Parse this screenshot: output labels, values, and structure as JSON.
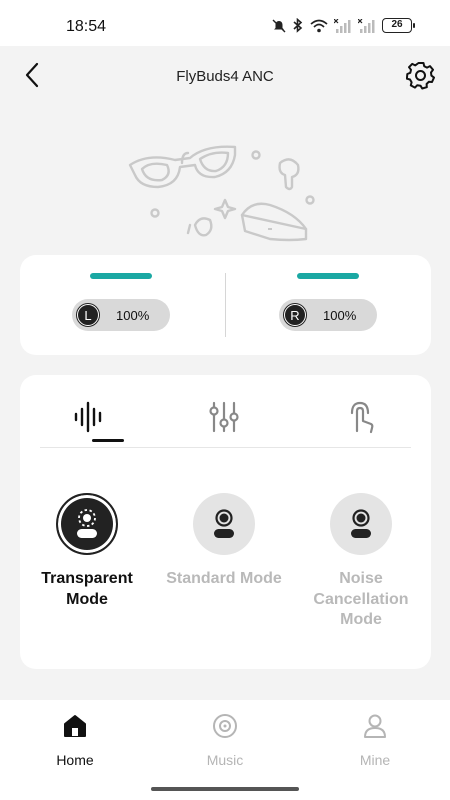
{
  "status_bar": {
    "time": "18:54",
    "battery": "26",
    "icons": [
      "mute-icon",
      "bluetooth-icon",
      "wifi-icon",
      "signal-icon",
      "signal-icon"
    ]
  },
  "header": {
    "title": "FlyBuds4 ANC",
    "back_icon": "back-icon",
    "settings_icon": "gear-icon"
  },
  "battery": {
    "left": {
      "letter": "L",
      "value": "100%",
      "level": 1.0
    },
    "right": {
      "letter": "R",
      "value": "100%",
      "level": 1.0
    },
    "accent_color": "#1aa8a3"
  },
  "mode_tabs": [
    {
      "icon": "sound-wave-icon",
      "selected": true
    },
    {
      "icon": "equalizer-icon",
      "selected": false
    },
    {
      "icon": "gesture-icon",
      "selected": false
    }
  ],
  "modes": {
    "transparent": {
      "label": "Transparent Mode",
      "selected": true
    },
    "standard": {
      "label": "Standard Mode",
      "selected": false
    },
    "noise": {
      "label": "Noise Cancellation Mode",
      "selected": false
    }
  },
  "bottom_nav": {
    "home": {
      "label": "Home",
      "icon": "home-icon",
      "active": true
    },
    "music": {
      "label": "Music",
      "icon": "music-disc-icon",
      "active": false
    },
    "mine": {
      "label": "Mine",
      "icon": "user-icon",
      "active": false
    }
  }
}
